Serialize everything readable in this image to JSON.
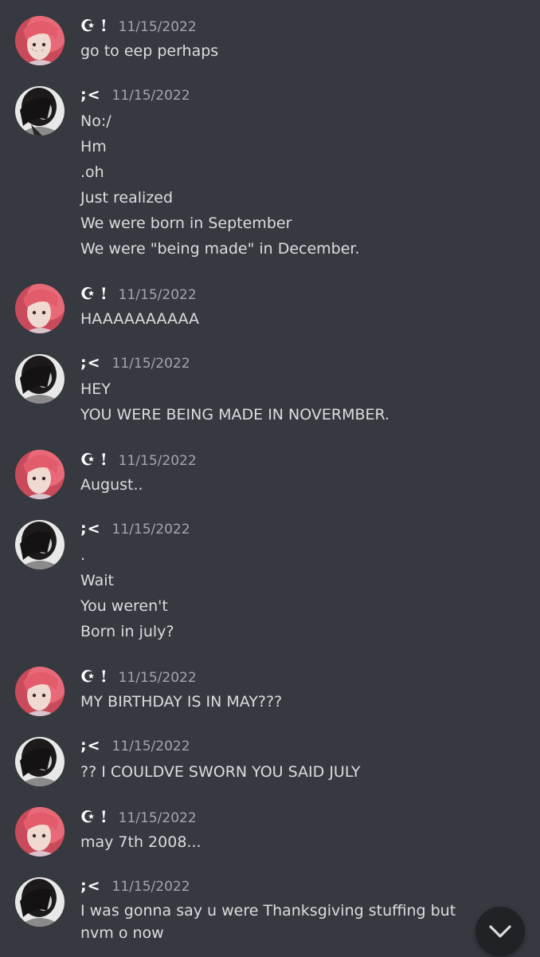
{
  "users": {
    "a": {
      "name": "☪︎ !",
      "avatar": "pink-hair-avatar"
    },
    "b": {
      "name": ";<",
      "avatar": "dark-hair-avatar"
    }
  },
  "messages": [
    {
      "user": "a",
      "time": "11/15/2022",
      "lines": [
        "go to eep perhaps"
      ]
    },
    {
      "user": "b",
      "time": "11/15/2022",
      "lines": [
        "No:/",
        "Hm",
        ".oh",
        "Just realized",
        "We were born in September",
        "We were \"being made\" in December."
      ]
    },
    {
      "user": "a",
      "time": "11/15/2022",
      "lines": [
        "HAAAAAAAAAA"
      ]
    },
    {
      "user": "b",
      "time": "11/15/2022",
      "lines": [
        "HEY",
        "YOU WERE BEING MADE IN NOVERMBER."
      ]
    },
    {
      "user": "a",
      "time": "11/15/2022",
      "lines": [
        "August.."
      ]
    },
    {
      "user": "b",
      "time": "11/15/2022",
      "lines": [
        ".",
        "Wait",
        "You weren't",
        "Born in july?"
      ]
    },
    {
      "user": "a",
      "time": "11/15/2022",
      "lines": [
        "MY BIRTHDAY IS IN MAY???"
      ]
    },
    {
      "user": "b",
      "time": "11/15/2022",
      "lines": [
        "?? I COULDVE SWORN YOU SAID JULY"
      ]
    },
    {
      "user": "a",
      "time": "11/15/2022",
      "lines": [
        "may 7th 2008..."
      ]
    },
    {
      "user": "b",
      "time": "11/15/2022",
      "lines": [
        "I was gonna say u were Thanksgiving stuffing but nvm o now"
      ]
    }
  ],
  "colors": {
    "background": "#36393f",
    "text": "#dcddde",
    "timestamp": "#a3a6aa",
    "username": "#ffffff",
    "scroll_button": "#202225"
  },
  "scroll_button": {
    "icon": "chevron-down-icon"
  }
}
